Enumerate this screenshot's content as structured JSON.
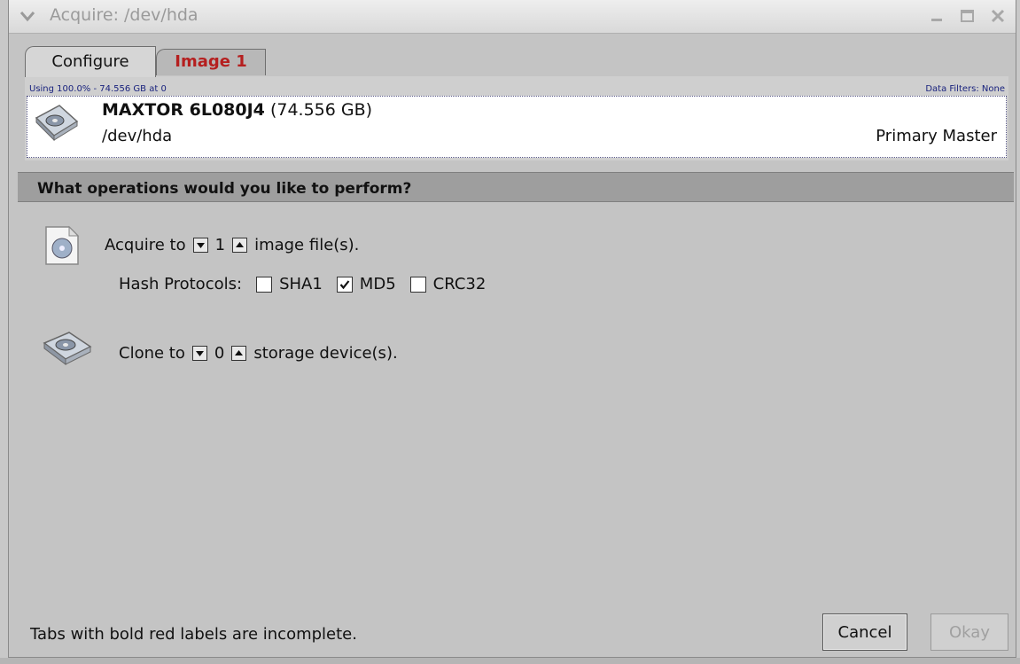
{
  "window": {
    "title": "Acquire: /dev/hda"
  },
  "tabs": [
    {
      "label": "Configure"
    },
    {
      "label": "Image 1"
    }
  ],
  "infobar": {
    "usage": "Using 100.0% - 74.556 GB at 0",
    "filters": "Data Filters: None"
  },
  "device": {
    "model": "MAXTOR 6L080J4",
    "size": "(74.556 GB)",
    "path": "/dev/hda",
    "position": "Primary Master"
  },
  "section": {
    "header": "What operations would you like to perform?"
  },
  "acquire": {
    "prefix": "Acquire to",
    "count": "1",
    "suffix": "image file(s)."
  },
  "hash": {
    "label": "Hash Protocols:",
    "options": [
      {
        "label": "SHA1",
        "checked": false
      },
      {
        "label": "MD5",
        "checked": true
      },
      {
        "label": "CRC32",
        "checked": false
      }
    ]
  },
  "clone": {
    "prefix": "Clone to",
    "count": "0",
    "suffix": "storage device(s)."
  },
  "footer": {
    "note": "Tabs with bold red labels are incomplete.",
    "cancel": "Cancel",
    "okay": "Okay"
  },
  "colors": {
    "incomplete_tab": "#b51f1f",
    "header_bar": "#9e9e9e",
    "infobar_text": "#1a237e"
  }
}
